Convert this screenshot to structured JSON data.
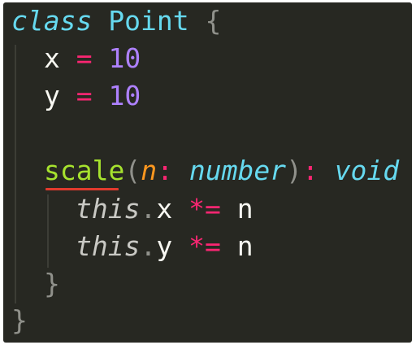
{
  "code": {
    "l1": {
      "kw": "class",
      "name": "Point",
      "brace": "{"
    },
    "l2": {
      "id": "x",
      "op": "=",
      "num": "10"
    },
    "l3": {
      "id": "y",
      "op": "=",
      "num": "10"
    },
    "l4": {
      "fn": "scale",
      "paren_open": "(",
      "param": "n",
      "colon1": ":",
      "type": "number",
      "paren_close": ")",
      "colon2": ":",
      "ret": "void",
      "brace": "{"
    },
    "l5": {
      "this": "this",
      "dot": ".",
      "prop": "x",
      "op": "*=",
      "rhs": "n"
    },
    "l6": {
      "this": "this",
      "dot": ".",
      "prop": "y",
      "op": "*=",
      "rhs": "n"
    },
    "l7": {
      "brace": "}"
    },
    "l8": {
      "brace": "}"
    }
  },
  "colors": {
    "background": "#272822",
    "keyword": "#66d9ef",
    "number": "#ae81ff",
    "operator": "#f92672",
    "parameter": "#fd971f",
    "function": "#a6e22e",
    "error_underline": "#e03a2d"
  }
}
